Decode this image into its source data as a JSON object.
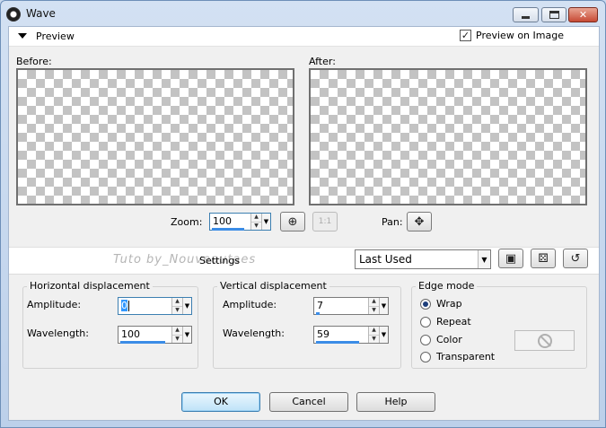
{
  "window": {
    "title": "Wave"
  },
  "preview": {
    "label": "Preview",
    "preview_on_image_label": "Preview on Image",
    "preview_on_image_checked": true
  },
  "before_label": "Before:",
  "after_label": "After:",
  "zoom": {
    "label": "Zoom:",
    "value": "100"
  },
  "pan": {
    "label": "Pan:"
  },
  "settings": {
    "label": "Settings",
    "preset": "Last Used"
  },
  "watermark": "Tuto by_Nouveautaes",
  "horizontal": {
    "legend": "Horizontal displacement",
    "amplitude_label": "Amplitude:",
    "amplitude_value": "0",
    "wavelength_label": "Wavelength:",
    "wavelength_value": "100"
  },
  "vertical": {
    "legend": "Vertical displacement",
    "amplitude_label": "Amplitude:",
    "amplitude_value": "7",
    "wavelength_label": "Wavelength:",
    "wavelength_value": "59"
  },
  "edge_mode": {
    "legend": "Edge mode",
    "options": [
      "Wrap",
      "Repeat",
      "Color",
      "Transparent"
    ],
    "selected": "Wrap"
  },
  "buttons": {
    "ok": "OK",
    "cancel": "Cancel",
    "help": "Help"
  }
}
